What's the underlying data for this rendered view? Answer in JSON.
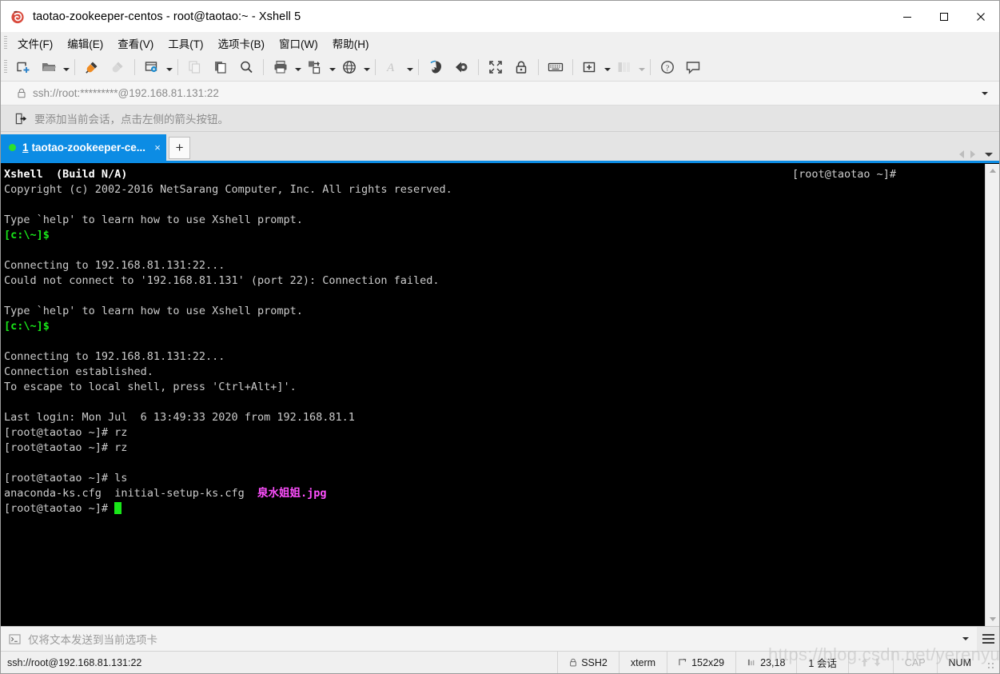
{
  "window": {
    "title": "taotao-zookeeper-centos - root@taotao:~ - Xshell 5",
    "app_icon": "xshell-logo-icon",
    "minimize": "—",
    "maximize": "□",
    "close": "✕"
  },
  "menubar": {
    "items": [
      {
        "label": "文件(F)",
        "name": "menu-file"
      },
      {
        "label": "编辑(E)",
        "name": "menu-edit"
      },
      {
        "label": "查看(V)",
        "name": "menu-view"
      },
      {
        "label": "工具(T)",
        "name": "menu-tools"
      },
      {
        "label": "选项卡(B)",
        "name": "menu-tabs"
      },
      {
        "label": "窗口(W)",
        "name": "menu-window"
      },
      {
        "label": "帮助(H)",
        "name": "menu-help"
      }
    ]
  },
  "toolbar": {
    "icons": [
      "new-session-icon",
      "open-folder-icon",
      "connect-icon",
      "disconnect-icon",
      "session-properties-icon",
      "copy-page-icon",
      "paste-icon",
      "find-icon",
      "print-icon",
      "transfer-file-icon",
      "web-browser-icon",
      "font-icon",
      "ssh-tunnel-icon",
      "zmodem-icon",
      "fullscreen-icon",
      "lock-icon",
      "keyboard-icon",
      "add-to-folder-icon",
      "layout-icon",
      "help-icon",
      "chat-icon"
    ]
  },
  "address": {
    "lock_icon": "lock-icon",
    "value": "ssh://root:*********@192.168.81.131:22",
    "placeholder": "ssh://root:*********@192.168.81.131:22",
    "dropdown_icon": "chevron-down-icon"
  },
  "session_hint": {
    "icon": "add-session-arrow-icon",
    "text": "要添加当前会话，点击左侧的箭头按钮。"
  },
  "tabbar": {
    "tabs": [
      {
        "number": "1",
        "label": "taotao-zookeeper-ce...",
        "close": "×",
        "status": "connected"
      }
    ],
    "new_tab_label": "+",
    "nav_prev_icon": "chevron-left-icon",
    "nav_next_icon": "chevron-right-icon",
    "nav_menu_icon": "chevron-down-icon"
  },
  "terminal": {
    "accent_green": "#19e619",
    "accent_magenta": "#ff4fff",
    "foreground": "#cccccc",
    "background": "#000000",
    "lines": [
      {
        "text": "Xshell  (Build N/A)",
        "style": "bold"
      },
      {
        "text": "Copyright (c) 2002-2016 NetSarang Computer, Inc. All rights reserved.",
        "style": "normal"
      },
      {
        "text": "",
        "style": "normal"
      },
      {
        "text": "Type `help' to learn how to use Xshell prompt.",
        "style": "normal"
      },
      {
        "text": "[c:\\~]$",
        "style": "green"
      },
      {
        "text": "",
        "style": "normal"
      },
      {
        "text": "Connecting to 192.168.81.131:22...",
        "style": "normal"
      },
      {
        "text": "Could not connect to '192.168.81.131' (port 22): Connection failed.",
        "style": "normal"
      },
      {
        "text": "",
        "style": "normal"
      },
      {
        "text": "Type `help' to learn how to use Xshell prompt.",
        "style": "normal"
      },
      {
        "text": "[c:\\~]$",
        "style": "green"
      },
      {
        "text": "",
        "style": "normal"
      },
      {
        "text": "Connecting to 192.168.81.131:22...",
        "style": "normal"
      },
      {
        "text": "Connection established.",
        "style": "normal"
      },
      {
        "text": "To escape to local shell, press 'Ctrl+Alt+]'.",
        "style": "normal"
      },
      {
        "text": "",
        "style": "normal"
      },
      {
        "text": "Last login: Mon Jul  6 13:49:33 2020 from 192.168.81.1",
        "style": "normal"
      },
      {
        "text": "[root@taotao ~]# rz",
        "style": "normal"
      },
      {
        "text": "[root@taotao ~]# rz",
        "style": "normal"
      },
      {
        "text": "",
        "style": "normal"
      },
      {
        "text": "[root@taotao ~]# ls",
        "style": "normal"
      },
      {
        "text": "anaconda-ks.cfg  initial-setup-ks.cfg  泉水姐姐.jpg",
        "style": "ls-output"
      },
      {
        "text": "[root@taotao ~]# ",
        "style": "prompt-cursor"
      }
    ],
    "ls_files": [
      "anaconda-ks.cfg",
      "initial-setup-ks.cfg",
      "泉水姐姐.jpg"
    ],
    "right_overlay_prompt": "[root@taotao ~]#",
    "annotation": {
      "type": "red-underline",
      "color": "#ff0000",
      "target": "泉水姐姐.jpg"
    }
  },
  "sendbar": {
    "icon": "terminal-prompt-icon",
    "text": "仅将文本发送到当前选项卡",
    "dropdown_icon": "chevron-down-icon",
    "menu_icon": "hamburger-menu-icon"
  },
  "statusbar": {
    "connection": "ssh://root@192.168.81.131:22",
    "security_icon": "lock-icon",
    "protocol": "SSH2",
    "term_type": "xterm",
    "size_icon": "resize-icon",
    "size": "152x29",
    "cursor_icon": "cursor-pos-icon",
    "cursor_pos": "23,18",
    "sessions": "1 会话",
    "upload_icon": "arrow-up-icon",
    "download_icon": "arrow-down-icon",
    "cap": "CAP",
    "num": "NUM"
  },
  "watermark": {
    "text": "https://blog.csdn.net/yerenyuan_pku"
  }
}
